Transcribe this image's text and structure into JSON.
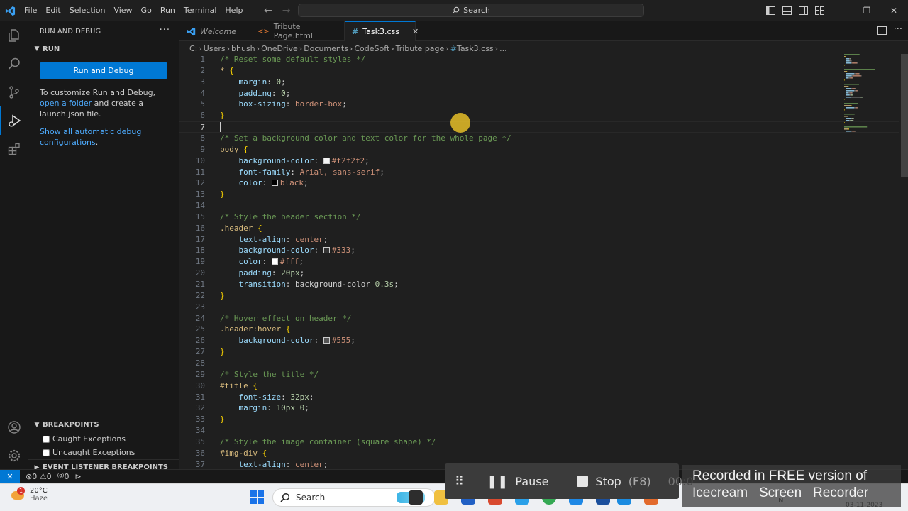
{
  "titlebar": {
    "menu": [
      "File",
      "Edit",
      "Selection",
      "View",
      "Go",
      "Run",
      "Terminal",
      "Help"
    ],
    "search_placeholder": "Search"
  },
  "sidebar": {
    "title": "RUN AND DEBUG",
    "run_section": "RUN",
    "run_button": "Run and Debug",
    "text_1": "To customize Run and Debug, ",
    "link_open_folder": "open a folder",
    "text_2": " and create a launch.json file.",
    "link_show_all": "Show all automatic debug configurations",
    "text_3": ".",
    "breakpoints_title": "BREAKPOINTS",
    "caught": "Caught Exceptions",
    "uncaught": "Uncaught Exceptions",
    "event_listener": "EVENT LISTENER BREAKPOINTS"
  },
  "tabs": [
    {
      "label": "Welcome",
      "icon": "vscode-icon"
    },
    {
      "label": "Tribute Page.html",
      "icon": "html-icon"
    },
    {
      "label": "Task3.css",
      "icon": "css-icon",
      "active": true
    }
  ],
  "breadcrumb": [
    "C:",
    "Users",
    "bhush",
    "OneDrive",
    "Documents",
    "CodeSoft",
    "Tribute page",
    "Task3.css",
    "..."
  ],
  "editor": {
    "current_line": 7,
    "lines": [
      [
        {
          "t": "com",
          "v": "/* Reset some default styles */"
        }
      ],
      [
        {
          "t": "sel",
          "v": "* "
        },
        {
          "t": "brace",
          "v": "{"
        }
      ],
      [
        {
          "t": "pun",
          "v": "    "
        },
        {
          "t": "prop",
          "v": "margin"
        },
        {
          "t": "pun",
          "v": ": "
        },
        {
          "t": "num",
          "v": "0"
        },
        {
          "t": "pun",
          "v": ";"
        }
      ],
      [
        {
          "t": "pun",
          "v": "    "
        },
        {
          "t": "prop",
          "v": "padding"
        },
        {
          "t": "pun",
          "v": ": "
        },
        {
          "t": "num",
          "v": "0"
        },
        {
          "t": "pun",
          "v": ";"
        }
      ],
      [
        {
          "t": "pun",
          "v": "    "
        },
        {
          "t": "prop",
          "v": "box-sizing"
        },
        {
          "t": "pun",
          "v": ": "
        },
        {
          "t": "str",
          "v": "border-box"
        },
        {
          "t": "pun",
          "v": ";"
        }
      ],
      [
        {
          "t": "brace",
          "v": "}"
        }
      ],
      [],
      [
        {
          "t": "com",
          "v": "/* Set a background color and text color for the whole page */"
        }
      ],
      [
        {
          "t": "sel",
          "v": "body "
        },
        {
          "t": "brace",
          "v": "{"
        }
      ],
      [
        {
          "t": "pun",
          "v": "    "
        },
        {
          "t": "prop",
          "v": "background-color"
        },
        {
          "t": "pun",
          "v": ": "
        },
        {
          "t": "swatch",
          "v": "#f2f2f2"
        },
        {
          "t": "str",
          "v": "#f2f2f2"
        },
        {
          "t": "pun",
          "v": ";"
        }
      ],
      [
        {
          "t": "pun",
          "v": "    "
        },
        {
          "t": "prop",
          "v": "font-family"
        },
        {
          "t": "pun",
          "v": ": "
        },
        {
          "t": "str",
          "v": "Arial, sans-serif"
        },
        {
          "t": "pun",
          "v": ";"
        }
      ],
      [
        {
          "t": "pun",
          "v": "    "
        },
        {
          "t": "prop",
          "v": "color"
        },
        {
          "t": "pun",
          "v": ": "
        },
        {
          "t": "swatch",
          "v": "#000000"
        },
        {
          "t": "str",
          "v": "black"
        },
        {
          "t": "pun",
          "v": ";"
        }
      ],
      [
        {
          "t": "brace",
          "v": "}"
        }
      ],
      [],
      [
        {
          "t": "com",
          "v": "/* Style the header section */"
        }
      ],
      [
        {
          "t": "sel",
          "v": ".header "
        },
        {
          "t": "brace",
          "v": "{"
        }
      ],
      [
        {
          "t": "pun",
          "v": "    "
        },
        {
          "t": "prop",
          "v": "text-align"
        },
        {
          "t": "pun",
          "v": ": "
        },
        {
          "t": "str",
          "v": "center"
        },
        {
          "t": "pun",
          "v": ";"
        }
      ],
      [
        {
          "t": "pun",
          "v": "    "
        },
        {
          "t": "prop",
          "v": "background-color"
        },
        {
          "t": "pun",
          "v": ": "
        },
        {
          "t": "swatch",
          "v": "#333333"
        },
        {
          "t": "str",
          "v": "#333"
        },
        {
          "t": "pun",
          "v": ";"
        }
      ],
      [
        {
          "t": "pun",
          "v": "    "
        },
        {
          "t": "prop",
          "v": "color"
        },
        {
          "t": "pun",
          "v": ": "
        },
        {
          "t": "swatch",
          "v": "#ffffff"
        },
        {
          "t": "str",
          "v": "#fff"
        },
        {
          "t": "pun",
          "v": ";"
        }
      ],
      [
        {
          "t": "pun",
          "v": "    "
        },
        {
          "t": "prop",
          "v": "padding"
        },
        {
          "t": "pun",
          "v": ": "
        },
        {
          "t": "num",
          "v": "20px"
        },
        {
          "t": "pun",
          "v": ";"
        }
      ],
      [
        {
          "t": "pun",
          "v": "    "
        },
        {
          "t": "prop",
          "v": "transition"
        },
        {
          "t": "pun",
          "v": ": background-color "
        },
        {
          "t": "num",
          "v": "0.3s"
        },
        {
          "t": "pun",
          "v": ";"
        }
      ],
      [
        {
          "t": "brace",
          "v": "}"
        }
      ],
      [],
      [
        {
          "t": "com",
          "v": "/* Hover effect on header */"
        }
      ],
      [
        {
          "t": "sel",
          "v": ".header:hover "
        },
        {
          "t": "brace",
          "v": "{"
        }
      ],
      [
        {
          "t": "pun",
          "v": "    "
        },
        {
          "t": "prop",
          "v": "background-color"
        },
        {
          "t": "pun",
          "v": ": "
        },
        {
          "t": "swatch",
          "v": "#555555"
        },
        {
          "t": "str",
          "v": "#555"
        },
        {
          "t": "pun",
          "v": ";"
        }
      ],
      [
        {
          "t": "brace",
          "v": "}"
        }
      ],
      [],
      [
        {
          "t": "com",
          "v": "/* Style the title */"
        }
      ],
      [
        {
          "t": "sel",
          "v": "#title "
        },
        {
          "t": "brace",
          "v": "{"
        }
      ],
      [
        {
          "t": "pun",
          "v": "    "
        },
        {
          "t": "prop",
          "v": "font-size"
        },
        {
          "t": "pun",
          "v": ": "
        },
        {
          "t": "num",
          "v": "32px"
        },
        {
          "t": "pun",
          "v": ";"
        }
      ],
      [
        {
          "t": "pun",
          "v": "    "
        },
        {
          "t": "prop",
          "v": "margin"
        },
        {
          "t": "pun",
          "v": ": "
        },
        {
          "t": "num",
          "v": "10px 0"
        },
        {
          "t": "pun",
          "v": ";"
        }
      ],
      [
        {
          "t": "brace",
          "v": "}"
        }
      ],
      [],
      [
        {
          "t": "com",
          "v": "/* Style the image container (square shape) */"
        }
      ],
      [
        {
          "t": "sel",
          "v": "#img-div "
        },
        {
          "t": "brace",
          "v": "{"
        }
      ],
      [
        {
          "t": "pun",
          "v": "    "
        },
        {
          "t": "prop",
          "v": "text-align"
        },
        {
          "t": "pun",
          "v": ": "
        },
        {
          "t": "str",
          "v": "center"
        },
        {
          "t": "pun",
          "v": ";"
        }
      ]
    ]
  },
  "statusbar": {
    "errors": "0",
    "warnings": "0",
    "ports": "0"
  },
  "taskbar": {
    "temperature": "20°C",
    "condition": "Haze",
    "weather_badge": "1",
    "search": "Search",
    "lang": "IN",
    "date": "03-11-2023"
  },
  "recorder": {
    "pause": "Pause",
    "stop": "Stop",
    "stop_key": "(F8)",
    "timer": "00:0",
    "watermark_1": "Recorded in FREE version of",
    "watermark_2": "Icecream   Screen   Recorder"
  },
  "colors": {
    "accent": "#0078d4",
    "link": "#4daafc"
  }
}
